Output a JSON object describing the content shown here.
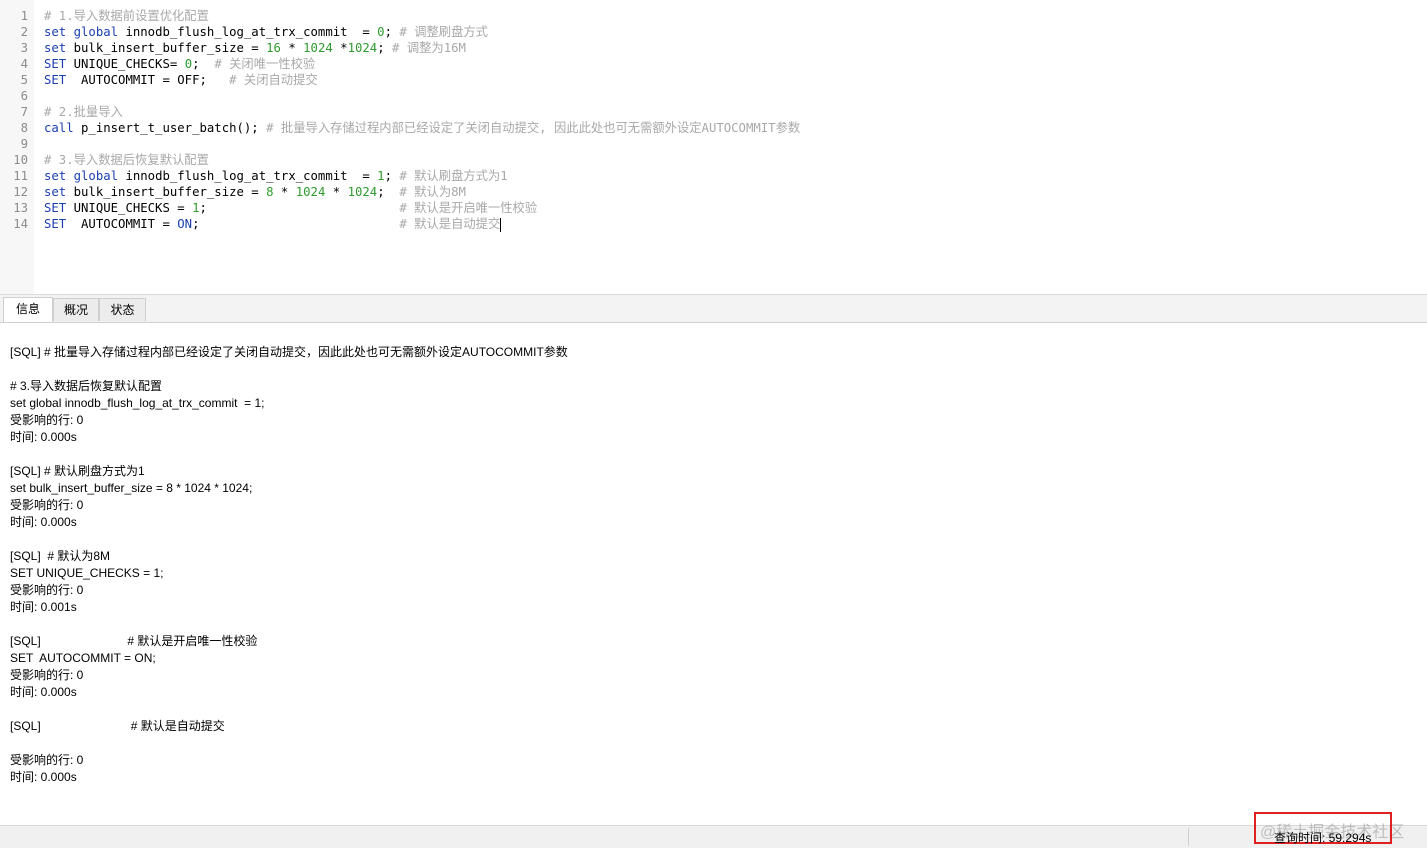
{
  "editor": {
    "lines": [
      {
        "n": "1",
        "parts": [
          [
            "cm",
            "# 1.导入数据前设置优化配置"
          ]
        ]
      },
      {
        "n": "2",
        "parts": [
          [
            "kw",
            "set"
          ],
          [
            "id",
            " "
          ],
          [
            "kw",
            "global"
          ],
          [
            "id",
            " innodb_flush_log_at_trx_commit  = "
          ],
          [
            "num",
            "0"
          ],
          [
            "id",
            "; "
          ],
          [
            "cm",
            "# 调整刷盘方式"
          ]
        ]
      },
      {
        "n": "3",
        "parts": [
          [
            "kw",
            "set"
          ],
          [
            "id",
            " bulk_insert_buffer_size = "
          ],
          [
            "num",
            "16"
          ],
          [
            "id",
            " * "
          ],
          [
            "num",
            "1024"
          ],
          [
            "id",
            " *"
          ],
          [
            "num",
            "1024"
          ],
          [
            "id",
            "; "
          ],
          [
            "cm",
            "# 调整为16M"
          ]
        ]
      },
      {
        "n": "4",
        "parts": [
          [
            "kw",
            "SET"
          ],
          [
            "id",
            " UNIQUE_CHECKS= "
          ],
          [
            "num",
            "0"
          ],
          [
            "id",
            ";  "
          ],
          [
            "cm",
            "# 关闭唯一性校验"
          ]
        ]
      },
      {
        "n": "5",
        "parts": [
          [
            "kw",
            "SET"
          ],
          [
            "id",
            "  AUTOCOMMIT = OFF;   "
          ],
          [
            "cm",
            "# 关闭自动提交"
          ]
        ]
      },
      {
        "n": "6",
        "parts": []
      },
      {
        "n": "7",
        "parts": [
          [
            "cm",
            "# 2.批量导入"
          ]
        ]
      },
      {
        "n": "8",
        "parts": [
          [
            "kw",
            "call"
          ],
          [
            "id",
            " p_insert_t_user_batch(); "
          ],
          [
            "cm",
            "# 批量导入存储过程内部已经设定了关闭自动提交, 因此此处也可无需额外设定AUTOCOMMIT参数"
          ]
        ]
      },
      {
        "n": "9",
        "parts": []
      },
      {
        "n": "10",
        "parts": [
          [
            "cm",
            "# 3.导入数据后恢复默认配置"
          ]
        ]
      },
      {
        "n": "11",
        "parts": [
          [
            "kw",
            "set"
          ],
          [
            "id",
            " "
          ],
          [
            "kw",
            "global"
          ],
          [
            "id",
            " innodb_flush_log_at_trx_commit  = "
          ],
          [
            "num",
            "1"
          ],
          [
            "id",
            "; "
          ],
          [
            "cm",
            "# 默认刷盘方式为1"
          ]
        ]
      },
      {
        "n": "12",
        "parts": [
          [
            "kw",
            "set"
          ],
          [
            "id",
            " bulk_insert_buffer_size = "
          ],
          [
            "num",
            "8"
          ],
          [
            "id",
            " * "
          ],
          [
            "num",
            "1024"
          ],
          [
            "id",
            " * "
          ],
          [
            "num",
            "1024"
          ],
          [
            "id",
            ";  "
          ],
          [
            "cm",
            "# 默认为8M"
          ]
        ]
      },
      {
        "n": "13",
        "parts": [
          [
            "kw",
            "SET"
          ],
          [
            "id",
            " UNIQUE_CHECKS = "
          ],
          [
            "num",
            "1"
          ],
          [
            "id",
            ";                          "
          ],
          [
            "cm",
            "# 默认是开启唯一性校验"
          ]
        ]
      },
      {
        "n": "14",
        "parts": [
          [
            "kw",
            "SET"
          ],
          [
            "id",
            "  AUTOCOMMIT = "
          ],
          [
            "kw",
            "ON"
          ],
          [
            "id",
            ";                           "
          ],
          [
            "cm",
            "# 默认是自动提交"
          ]
        ]
      }
    ]
  },
  "tabs": [
    {
      "label": "信息",
      "active": true
    },
    {
      "label": "概况",
      "active": false
    },
    {
      "label": "状态",
      "active": false
    }
  ],
  "output": {
    "lines": [
      "[SQL] # 批量导入存储过程内部已经设定了关闭自动提交，因此此处也可无需额外设定AUTOCOMMIT参数",
      "",
      "# 3.导入数据后恢复默认配置",
      "set global innodb_flush_log_at_trx_commit  = 1;",
      "受影响的行: 0",
      "时间: 0.000s",
      "",
      "[SQL] # 默认刷盘方式为1",
      "set bulk_insert_buffer_size = 8 * 1024 * 1024;",
      "受影响的行: 0",
      "时间: 0.000s",
      "",
      "[SQL]  # 默认为8M",
      "SET UNIQUE_CHECKS = 1;",
      "受影响的行: 0",
      "时间: 0.001s",
      "",
      "[SQL]                          # 默认是开启唯一性校验",
      "SET  AUTOCOMMIT = ON;",
      "受影响的行: 0",
      "时间: 0.000s",
      "",
      "[SQL]                           # 默认是自动提交",
      "",
      "受影响的行: 0",
      "时间: 0.000s"
    ]
  },
  "statusbar": {
    "query_time": "查询时间: 59.294s",
    "watermark": "@稀土掘金技术社区"
  },
  "colors": {
    "keyword": "#1c40b0",
    "number": "#2e9b2e",
    "comment": "#a8a8a8",
    "highlight_box": "#e02020"
  }
}
